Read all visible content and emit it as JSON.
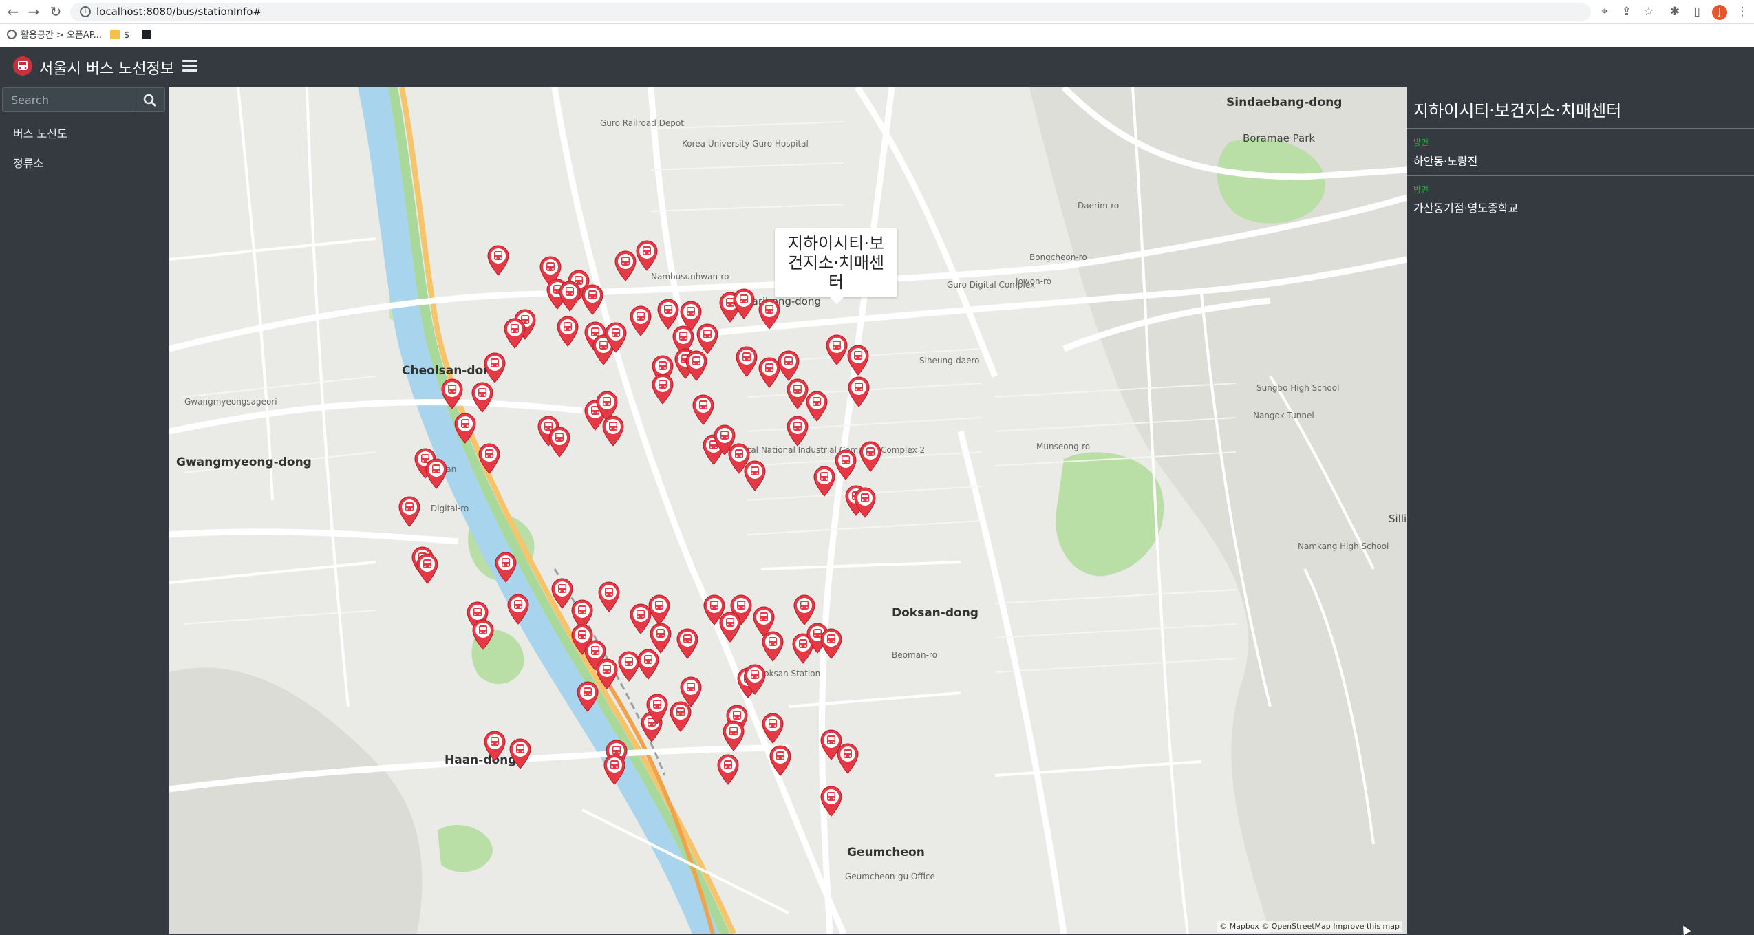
{
  "browser": {
    "url": "localhost:8080/bus/stationInfo#",
    "bookmarks": [
      "활용공간 > 오픈AP...",
      "$",
      ""
    ],
    "profile_initial": "J"
  },
  "app": {
    "brand": "서울시 버스 노선정보",
    "search_placeholder": "Search",
    "sidebar": [
      {
        "label": "버스 노선도"
      },
      {
        "label": "정류소"
      }
    ]
  },
  "map": {
    "popup_title": "지하이시티·보건지소·치매센터",
    "attribution": "© Mapbox © OpenStreetMap Improve this map",
    "marker_color": "#e63946",
    "labels": [
      {
        "text": "Cheolsan-dong",
        "kind": "big"
      },
      {
        "text": "Gwangmyeong-dong",
        "kind": "big"
      },
      {
        "text": "Haan-dong",
        "kind": "big"
      },
      {
        "text": "Doksan-dong",
        "kind": "big"
      },
      {
        "text": "Geumcheon",
        "kind": "big"
      },
      {
        "text": "Sindaebang-dong",
        "kind": "big"
      },
      {
        "text": "Boramae Park",
        "kind": "normal"
      },
      {
        "text": "Guro Railroad Depot",
        "kind": "small"
      },
      {
        "text": "Korea University Guro Hospital",
        "kind": "small"
      },
      {
        "text": "Garibong-dong",
        "kind": "normal"
      },
      {
        "text": "Seoul Digital National Industrial Complex, Complex 2",
        "kind": "small"
      },
      {
        "text": "Nambusunhwan-ro",
        "kind": "small"
      },
      {
        "text": "Doksan Station",
        "kind": "small"
      },
      {
        "text": "Cheolsan",
        "kind": "small"
      },
      {
        "text": "Gwangmyeongsageori",
        "kind": "small"
      },
      {
        "text": "Guro Digital Complex",
        "kind": "small"
      },
      {
        "text": "Sungbo High School",
        "kind": "small"
      },
      {
        "text": "Namkang High School",
        "kind": "small"
      },
      {
        "text": "Nangok Tunnel",
        "kind": "small"
      },
      {
        "text": "Munseong-ro",
        "kind": "small"
      },
      {
        "text": "Digital-ro",
        "kind": "small"
      },
      {
        "text": "Beoman-ro",
        "kind": "small"
      },
      {
        "text": "Siheung-daero",
        "kind": "small"
      },
      {
        "text": "Geumcheon-gu Office",
        "kind": "small"
      },
      {
        "text": "Daerim-ro",
        "kind": "small"
      },
      {
        "text": "Jowon-ro",
        "kind": "small"
      },
      {
        "text": "Bongcheon-ro",
        "kind": "small"
      },
      {
        "text": "Sillim",
        "kind": "normal"
      }
    ]
  },
  "station": {
    "title": "지하이시티·보건지소·치매센터",
    "directions": [
      {
        "label": "방면",
        "name": "하안동·노량진"
      },
      {
        "label": "방면",
        "name": "가산동기점·영도중학교"
      }
    ]
  }
}
